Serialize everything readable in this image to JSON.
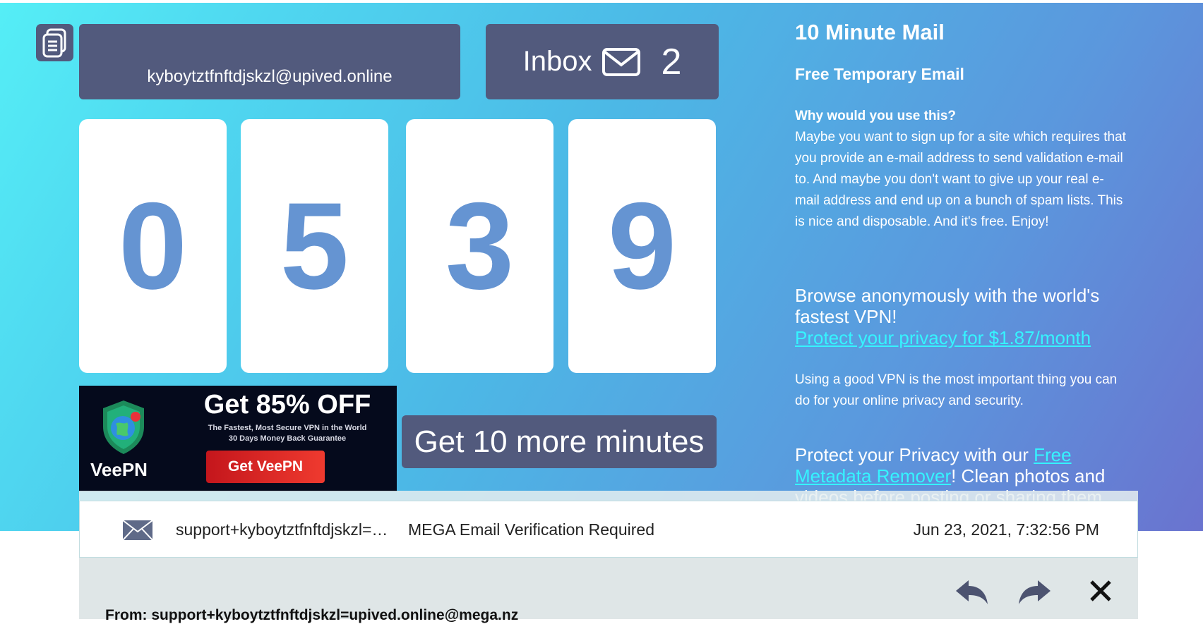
{
  "email_address": "kyboytztfnftdjskzl@upived.online",
  "inbox": {
    "label": "Inbox",
    "count": "2"
  },
  "timer_digits": [
    "0",
    "5",
    "3",
    "9"
  ],
  "ad": {
    "headline": "Get 85% OFF",
    "subline_1": "The Fastest, Most Secure VPN in the World",
    "subline_2": "30 Days Money Back Guarantee",
    "button": "Get VeePN",
    "brand": "VeePN"
  },
  "more_minutes_button": "Get 10 more minutes",
  "sidebar": {
    "title": "10 Minute Mail",
    "subtitle": "Free Temporary Email",
    "why_heading": "Why would you use this?",
    "why_body": "Maybe you want to sign up for a site which requires that you provide an e-mail address to send validation e-mail to. And maybe you don't want to give up your real e-mail address and end up on a bunch of spam lists. This is nice and disposable. And it's free. Enjoy!",
    "vpn_heading": "Browse anonymously with the world's fastest VPN!",
    "vpn_link": "Protect your privacy for $1.87/month",
    "vpn_note": "Using a good VPN is the most important thing you can do for your online privacy and security.",
    "meta_prefix": "Protect your Privacy with our ",
    "meta_link": "Free Metadata Remover",
    "meta_suffix": "! Clean photos and videos before posting or sharing them"
  },
  "message": {
    "from_short": "support+kyboytztfnftdjskzl=…",
    "subject": "MEGA Email Verification Required",
    "date": "Jun 23, 2021, 7:32:56 PM",
    "from_full": "From: support+kyboytztfnftdjskzl=upived.online@mega.nz"
  },
  "icons": {
    "copy": "copy-icon",
    "inbox": "envelope-icon",
    "reply": "reply-icon",
    "forward": "forward-icon",
    "delete": "close-icon"
  },
  "colors": {
    "panel": "#525a7d",
    "digit": "#6594d2",
    "link": "#35f4ff"
  }
}
